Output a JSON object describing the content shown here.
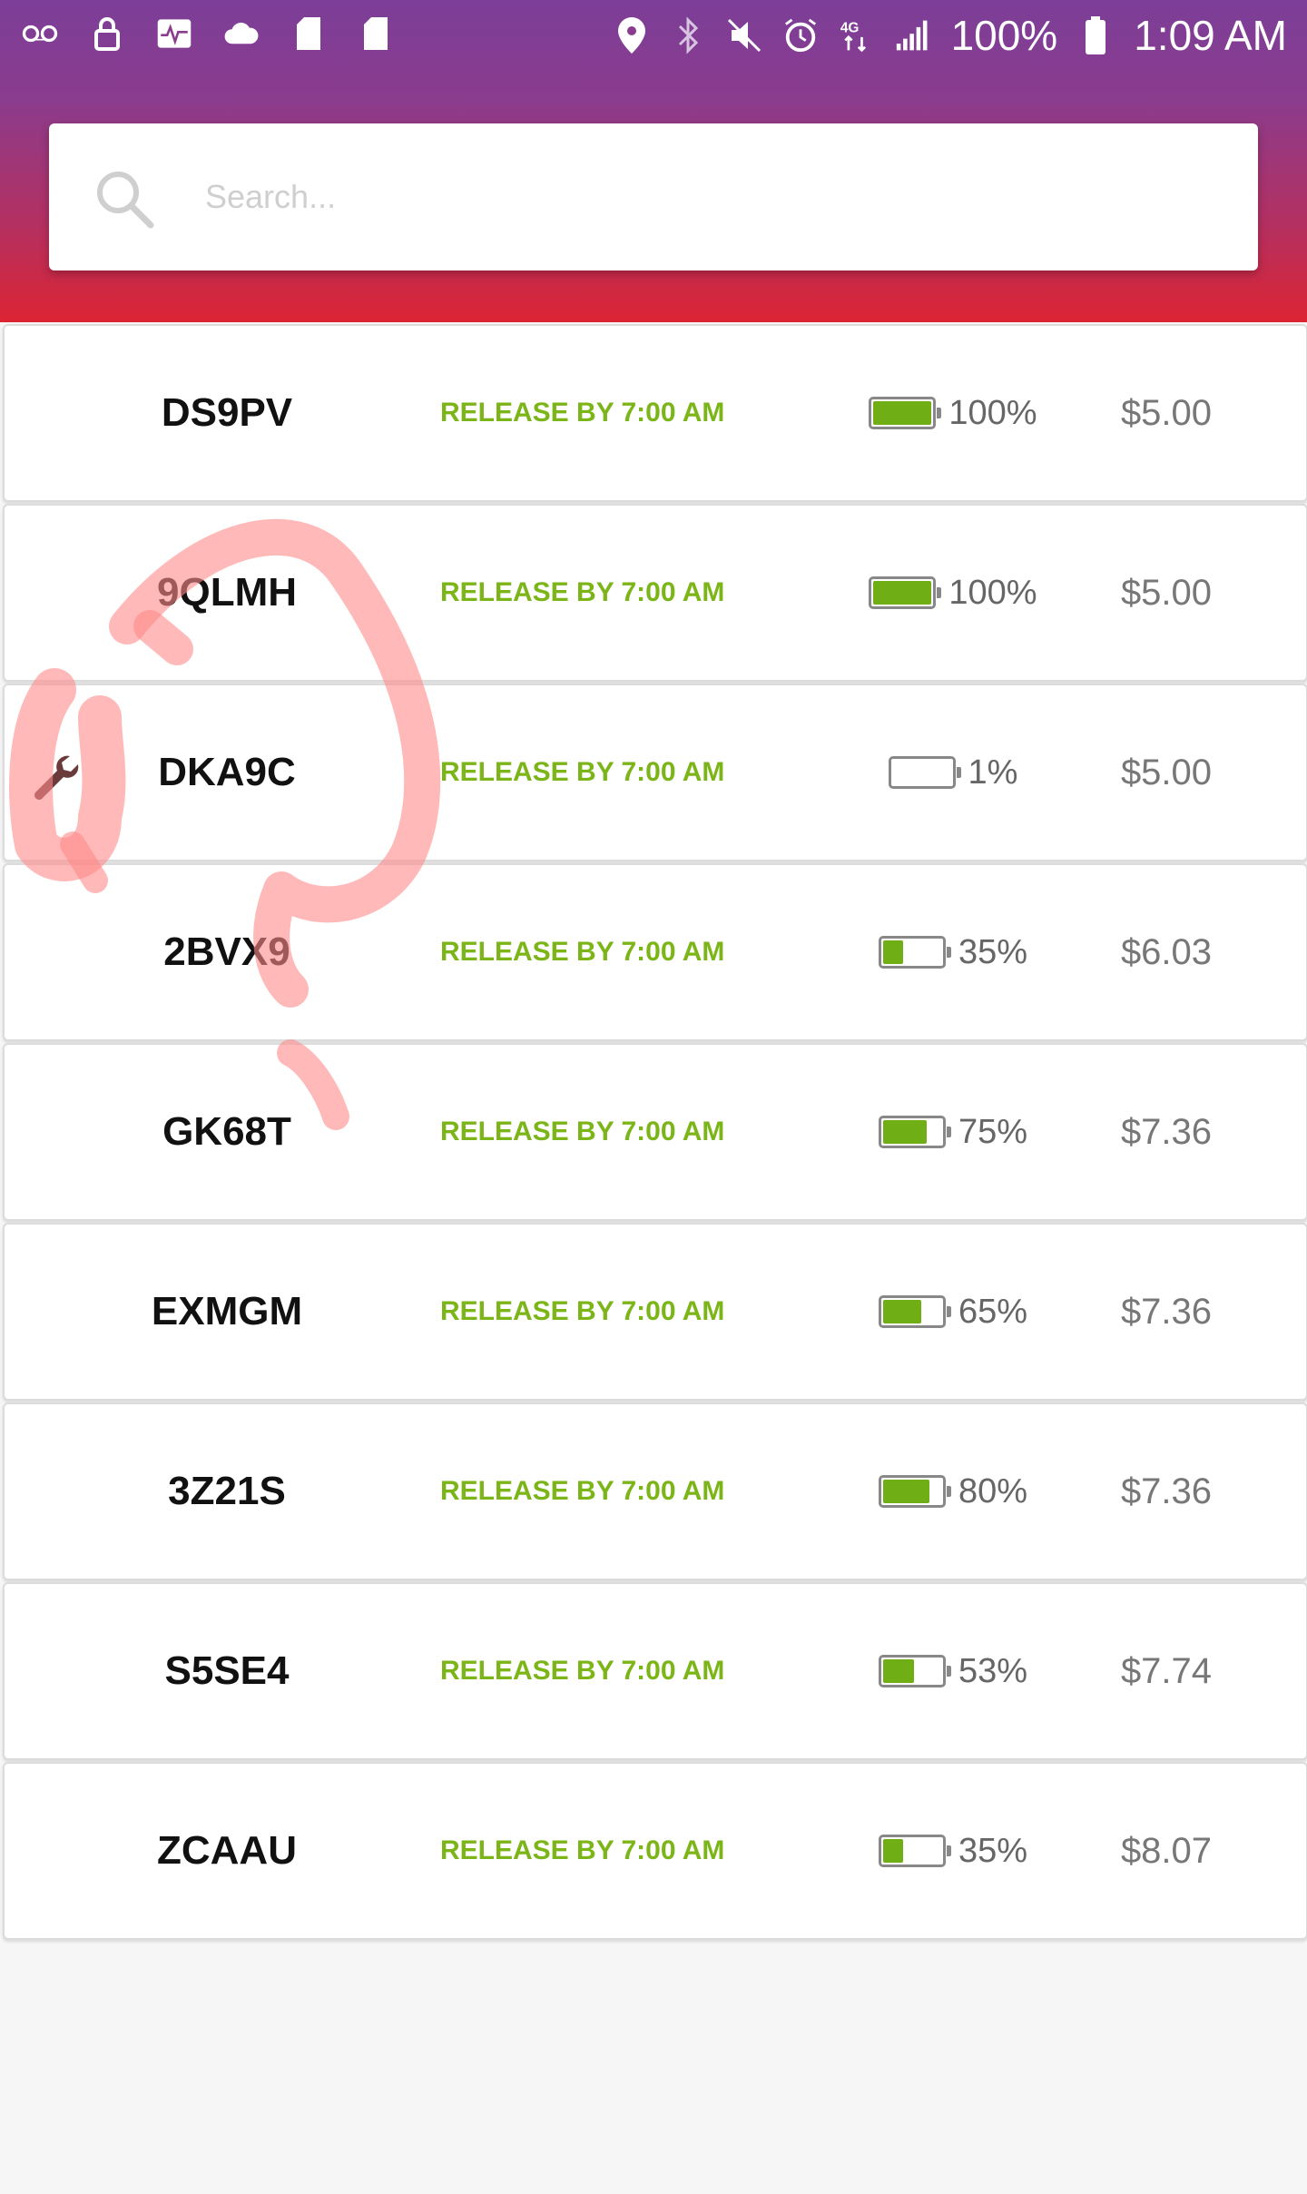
{
  "status_bar": {
    "battery_percent": "100%",
    "time": "1:09 AM",
    "network": "4G",
    "icons_left": [
      "voicemail-icon",
      "lock-icon",
      "activity-icon",
      "cloud-icon",
      "sd-card-icon",
      "sd-card-icon"
    ],
    "icons_right": [
      "location-icon",
      "bluetooth-icon",
      "mute-icon",
      "alarm-icon",
      "4g-lte-icon",
      "signal-icon",
      "battery-icon"
    ]
  },
  "search": {
    "placeholder": "Search..."
  },
  "colors": {
    "header_top": "#7c3e98",
    "header_bottom": "#dc2433",
    "release_green": "#7cb518",
    "battery_fill": "#6fae14"
  },
  "rows": [
    {
      "code": "DS9PV",
      "release": "RELEASE BY 7:00 AM",
      "battery_text": "100%",
      "battery_level": 100,
      "price": "$5.00",
      "wrench": false
    },
    {
      "code": "9QLMH",
      "release": "RELEASE BY 7:00 AM",
      "battery_text": "100%",
      "battery_level": 100,
      "price": "$5.00",
      "wrench": false
    },
    {
      "code": "DKA9C",
      "release": "RELEASE BY 7:00 AM",
      "battery_text": "1%",
      "battery_level": 1,
      "price": "$5.00",
      "wrench": true
    },
    {
      "code": "2BVX9",
      "release": "RELEASE BY 7:00 AM",
      "battery_text": "35%",
      "battery_level": 35,
      "price": "$6.03",
      "wrench": false
    },
    {
      "code": "GK68T",
      "release": "RELEASE BY 7:00 AM",
      "battery_text": "75%",
      "battery_level": 75,
      "price": "$7.36",
      "wrench": false
    },
    {
      "code": "EXMGM",
      "release": "RELEASE BY 7:00 AM",
      "battery_text": "65%",
      "battery_level": 65,
      "price": "$7.36",
      "wrench": false
    },
    {
      "code": "3Z21S",
      "release": "RELEASE BY 7:00 AM",
      "battery_text": "80%",
      "battery_level": 80,
      "price": "$7.36",
      "wrench": false
    },
    {
      "code": "S5SE4",
      "release": "RELEASE BY 7:00 AM",
      "battery_text": "53%",
      "battery_level": 53,
      "price": "$7.74",
      "wrench": false
    },
    {
      "code": "ZCAAU",
      "release": "RELEASE BY 7:00 AM",
      "battery_text": "35%",
      "battery_level": 35,
      "price": "$8.07",
      "wrench": false
    }
  ]
}
